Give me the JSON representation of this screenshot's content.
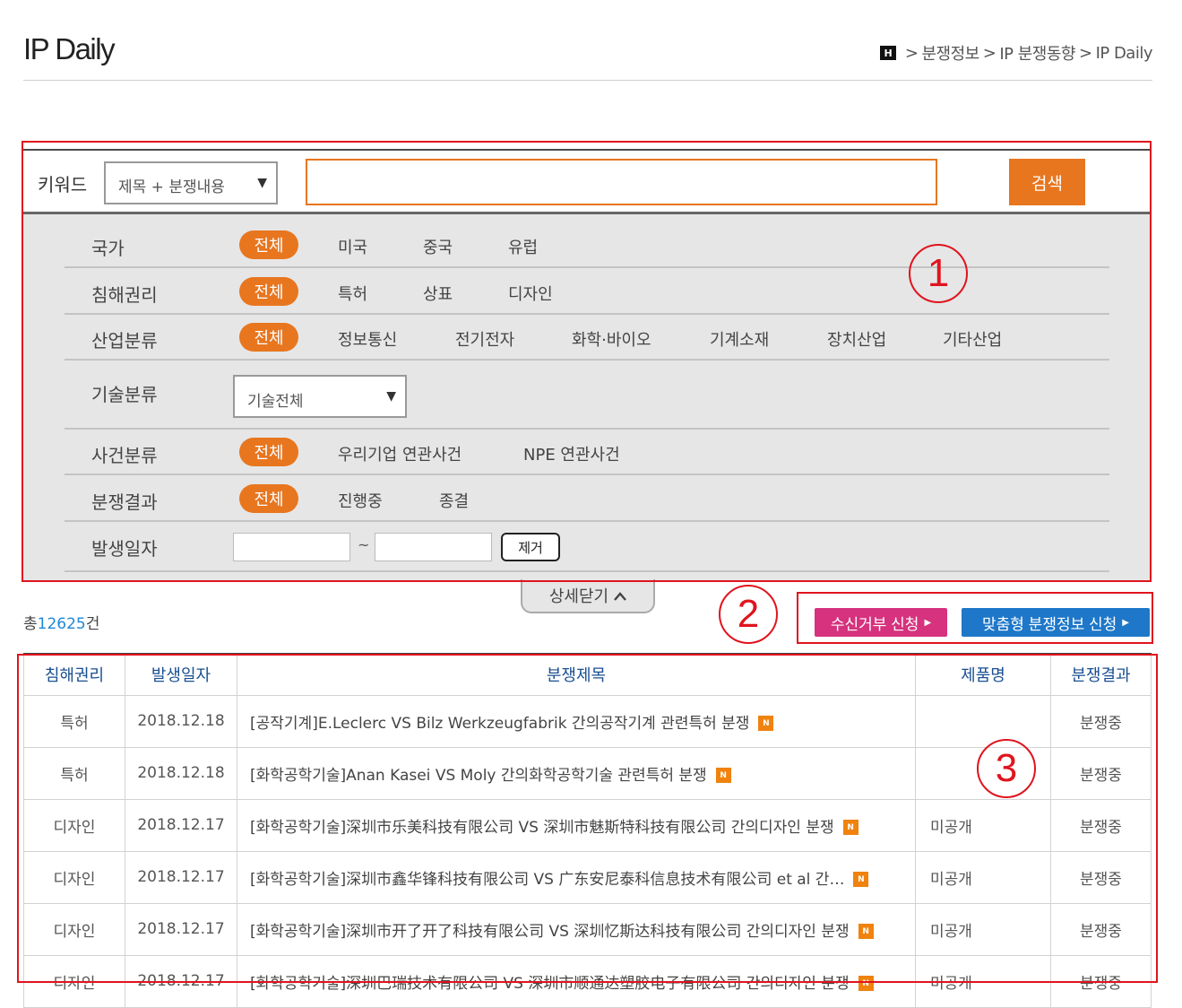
{
  "header": {
    "title": "IP Daily",
    "breadcrumb": [
      "분쟁정보",
      "IP 분쟁동향",
      "IP Daily"
    ],
    "home_icon": "home-icon"
  },
  "search": {
    "label": "키워드",
    "scope_selected": "제목 + 분쟁내용",
    "query": "",
    "button": "검색"
  },
  "filters": {
    "country": {
      "label": "국가",
      "options": [
        "전체",
        "미국",
        "중국",
        "유럽"
      ],
      "selected": "전체"
    },
    "right": {
      "label": "침해권리",
      "options": [
        "전체",
        "특허",
        "상표",
        "디자인"
      ],
      "selected": "전체"
    },
    "industry": {
      "label": "산업분류",
      "options": [
        "전체",
        "정보통신",
        "전기전자",
        "화학·바이오",
        "기계소재",
        "장치산업",
        "기타산업"
      ],
      "selected": "전체"
    },
    "tech": {
      "label": "기술분류",
      "selected": "기술전체"
    },
    "case": {
      "label": "사건분류",
      "options": [
        "전체",
        "우리기업 연관사건",
        "NPE 연관사건"
      ],
      "selected": "전체"
    },
    "result": {
      "label": "분쟁결과",
      "options": [
        "전체",
        "진행중",
        "종결"
      ],
      "selected": "전체"
    },
    "date": {
      "label": "발생일자",
      "from": "",
      "to": "",
      "separator": "~",
      "clear": "제거"
    },
    "toggle": "상세닫기"
  },
  "summary": {
    "prefix": "총",
    "count": "12625",
    "suffix": "건"
  },
  "actions": {
    "reject": "수신거부 신청",
    "custom": "맞춤형 분쟁정보 신청"
  },
  "annotations": [
    "1",
    "2",
    "3"
  ],
  "table": {
    "columns": [
      "침해권리",
      "발생일자",
      "분쟁제목",
      "제품명",
      "분쟁결과"
    ],
    "new_badge": "N",
    "rows": [
      {
        "right": "특허",
        "date": "2018.12.18",
        "title": "[공작기계]E.Leclerc VS Bilz Werkzeugfabrik 간의공작기계 관련특허 분쟁",
        "product": "",
        "result": "분쟁중"
      },
      {
        "right": "특허",
        "date": "2018.12.18",
        "title": "[화학공학기술]Anan Kasei VS Moly 간의화학공학기술 관련특허 분쟁",
        "product": "",
        "result": "분쟁중"
      },
      {
        "right": "디자인",
        "date": "2018.12.17",
        "title": "[화학공학기술]深圳市乐美科技有限公司 VS 深圳市魅斯特科技有限公司 간의디자인 분쟁",
        "product": "미공개",
        "result": "분쟁중"
      },
      {
        "right": "디자인",
        "date": "2018.12.17",
        "title": "[화학공학기술]深圳市鑫华锋科技有限公司 VS 广东安尼泰科信息技术有限公司 et al 간…",
        "product": "미공개",
        "result": "분쟁중"
      },
      {
        "right": "디자인",
        "date": "2018.12.17",
        "title": "[화학공학기술]深圳市开了开了科技有限公司 VS 深圳忆斯达科技有限公司 간의디자인 분쟁",
        "product": "미공개",
        "result": "분쟁중"
      },
      {
        "right": "디자인",
        "date": "2018.12.17",
        "title": "[화학공학기술]深圳巴瑞技术有限公司 VS 深圳市顺通达塑胶电子有限公司 간의디자인 분쟁",
        "product": "미공개",
        "result": "분쟁중"
      }
    ]
  }
}
